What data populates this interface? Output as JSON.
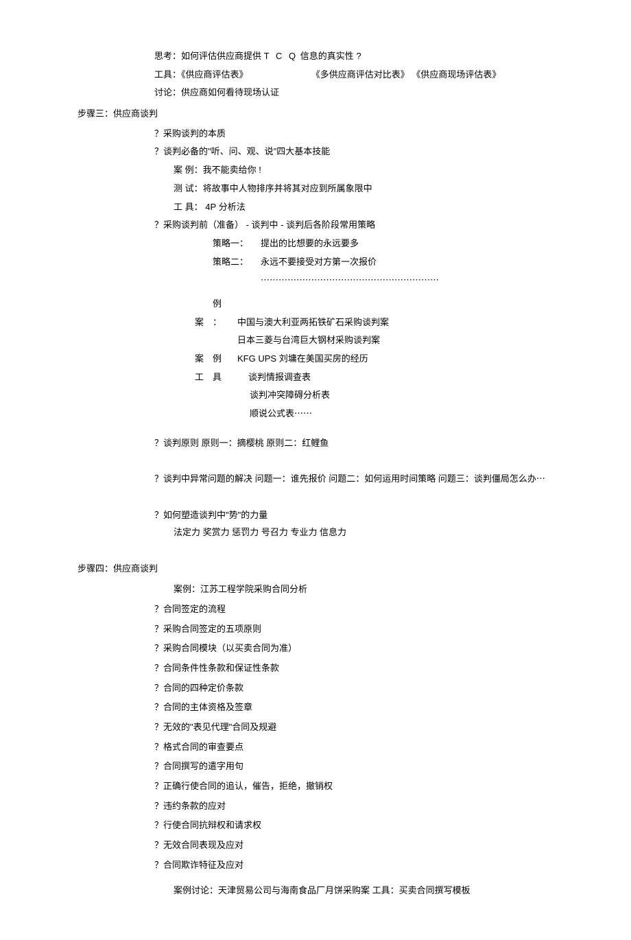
{
  "intro": {
    "l1a": "思考：如何评估供应商提供",
    "l1b": "T C Q",
    "l1c": "信息的真实性 ?",
    "l2a": "工具：《供应商评估表》",
    "l2b": "《多供应商评估对比表》 《供应商现场评估表》",
    "l3": "讨论：供应商如何看待现场认证"
  },
  "step3": {
    "title": "步骤三：供应商谈判",
    "l1": "？采购谈判的本质",
    "l2": "？谈判必备的\"听、问、观、说\"四大基本技能",
    "l2a": "案  例：我不能卖给你 !",
    "l2b": "测  试：将故事中人物排序并将其对应到所属象限中",
    "l2c_a": "工  具：",
    "l2c_b": "4P",
    "l2c_c": " 分析法",
    "l3": "？采购谈判前（准备）  - 谈判中  - 谈判后各阶段常用策略",
    "s1_label": "策略一：",
    "s1_text": "提出的比想要的永远要多",
    "s2_label": "策略二：",
    "s2_text": "永远不要接受对方第一次报价",
    "dots": "⋯⋯⋯⋯⋯⋯⋯⋯⋯⋯⋯⋯⋯⋯⋯⋯⋯⋯⋯⋯",
    "case_label": "案",
    "li_label": "例",
    "colon": "：",
    "c1": "中国与澳大利亚两拓铁矿石采购谈判案",
    "c2": "日本三菱与台湾巨大钢材采购谈判案",
    "c3a": "KFG UPS",
    "c3b": "刘墉在美国买房的经历",
    "tool_label": "工",
    "ju_label": "具",
    "t1": "谈判情报调查表",
    "t2": "谈判冲突障碍分析表",
    "t3": "顺说公式表⋯⋯",
    "l4": "？谈判原则  原则一：摘樱桃  原则二：红鲤鱼",
    "l5": "？谈判中异常问题的解决  问题一：谁先报价  问题二：如何运用时间策略  问题三：谈判僵局怎么办⋯",
    "l6": "？如何塑造谈判中\"势\"的力量",
    "l6a": "法定力  奖赏力  惩罚力  号召力  专业力  信息力"
  },
  "step4": {
    "title": "步骤四：供应商谈判",
    "case": "案例：江苏工程学院采购合同分析",
    "items": [
      "？合同签定的流程",
      "？采购合同签定的五项原则",
      "？采购合同模块（以买卖合同为准）",
      "？合同条件性条款和保证性条款",
      "？合同的四种定价条款",
      "？合同的主体资格及签章",
      "？无效的\"表见代理\"合同及规避",
      "？格式合同的审查要点",
      "？合同撰写的遣字用句",
      "？正确行使合同的追认，催告，拒绝，撤销权",
      "？违约条款的应对",
      "？行使合同抗辩权和请求权",
      "？无效合同表现及应对",
      "？合同欺诈特征及应对"
    ],
    "foot": "案例讨论：天津贸易公司与海南食品厂月饼采购案  工具：买卖合同撰写模板"
  }
}
